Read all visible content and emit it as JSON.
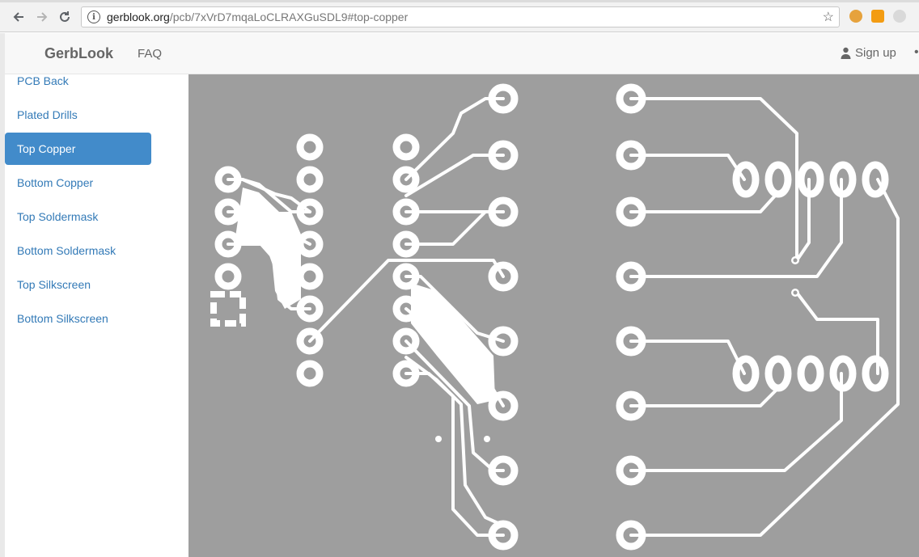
{
  "browser": {
    "url_host": "gerblook.org",
    "url_path": "/pcb/7xVrD7mqaLoCLRAXGuSDL9#top-copper",
    "back_icon": "arrow-left-icon",
    "forward_icon": "arrow-right-icon",
    "reload_icon": "reload-icon",
    "info_glyph": "i",
    "star_glyph": "☆"
  },
  "header": {
    "brand": "GerbLook",
    "faq": "FAQ",
    "signup": "Sign up",
    "more_glyph": "•"
  },
  "sidebar": {
    "items": [
      {
        "label": "PCB Back",
        "active": false
      },
      {
        "label": "Plated Drills",
        "active": false
      },
      {
        "label": "Top Copper",
        "active": true
      },
      {
        "label": "Bottom Copper",
        "active": false
      },
      {
        "label": "Top Soldermask",
        "active": false
      },
      {
        "label": "Bottom Soldermask",
        "active": false
      },
      {
        "label": "Top Silkscreen",
        "active": false
      },
      {
        "label": "Bottom Silkscreen",
        "active": false
      }
    ]
  },
  "colors": {
    "board_background": "#9e9e9e",
    "copper": "#ffffff",
    "active_item": "#428bca",
    "link": "#337ab7"
  }
}
